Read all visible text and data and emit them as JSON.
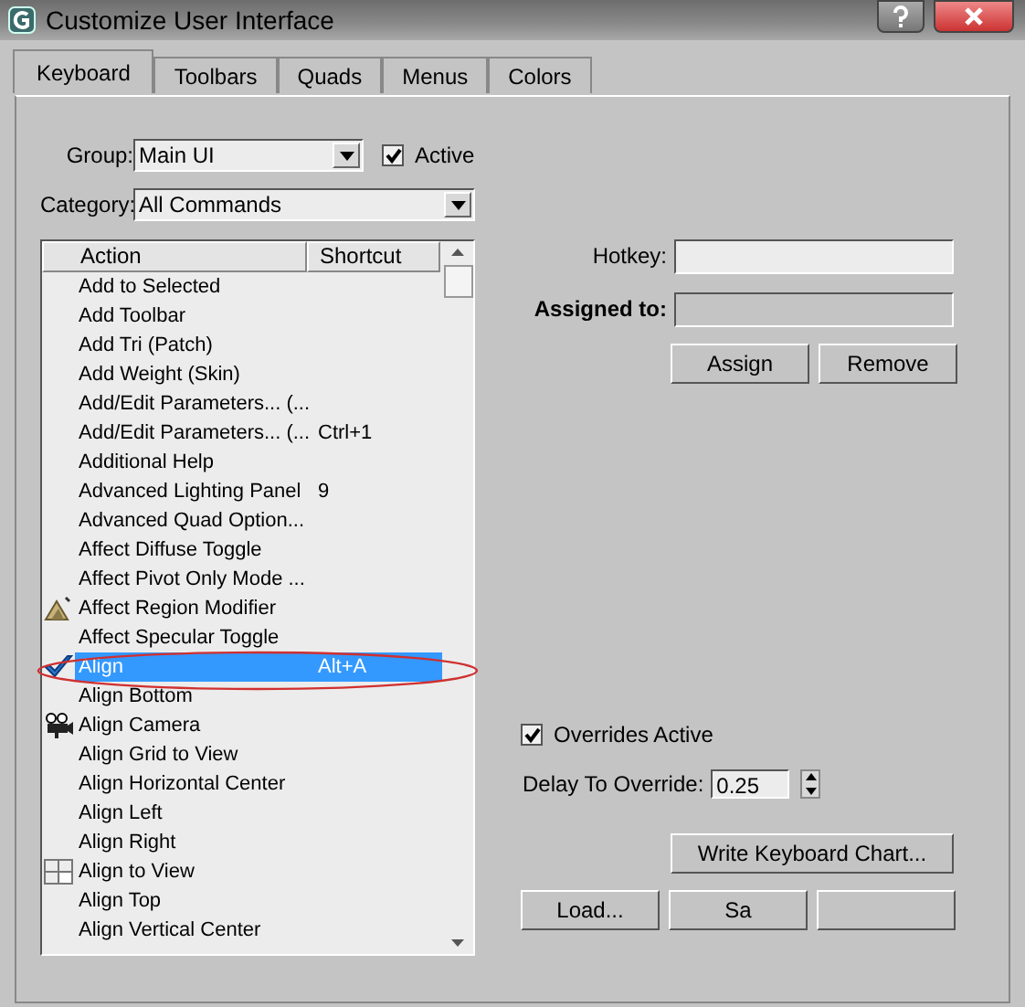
{
  "window": {
    "title": "Customize User Interface"
  },
  "tabs": [
    {
      "label": "Keyboard",
      "selected": true
    },
    {
      "label": "Toolbars",
      "selected": false
    },
    {
      "label": "Quads",
      "selected": false
    },
    {
      "label": "Menus",
      "selected": false
    },
    {
      "label": "Colors",
      "selected": false
    }
  ],
  "group": {
    "label": "Group:",
    "value": "Main UI"
  },
  "active": {
    "label": "Active",
    "checked": true
  },
  "category": {
    "label": "Category:",
    "value": "All Commands"
  },
  "table": {
    "columns": [
      "Action",
      "Shortcut"
    ],
    "rows": [
      {
        "action": "Add to Selected",
        "selected": false,
        "kind": "plain"
      },
      {
        "action": "Add Toolbar",
        "selected": false,
        "kind": "plain"
      },
      {
        "action": "Add Tri (Patch)",
        "selected": false,
        "kind": "plain"
      },
      {
        "action": "Add Weight (Skin)",
        "selected": false,
        "kind": "plain"
      },
      {
        "action": "Add/Edit Parameters... (...",
        "selected": false,
        "kind": "plain"
      },
      {
        "action": "Add/Edit Parameters... (...",
        "shortcut": "Ctrl+1",
        "selected": false,
        "kind": "plain"
      },
      {
        "action": "Additional Help",
        "selected": false,
        "kind": "plain"
      },
      {
        "action": "Advanced Lighting Panel",
        "shortcut": "9",
        "selected": false,
        "kind": "plain"
      },
      {
        "action": "Advanced Quad Option...",
        "selected": false,
        "kind": "plain"
      },
      {
        "action": "Affect Diffuse Toggle",
        "selected": false,
        "kind": "plain"
      },
      {
        "action": "Affect Pivot Only Mode ...",
        "selected": false,
        "kind": "plain"
      },
      {
        "action": "Affect Region Modifier",
        "selected": false,
        "kind": "region"
      },
      {
        "action": "Affect Specular Toggle",
        "selected": false,
        "kind": "plain"
      },
      {
        "action": "Align",
        "shortcut": "Alt+A",
        "selected": true,
        "kind": "align"
      },
      {
        "action": "Align Bottom",
        "selected": false,
        "kind": "plain"
      },
      {
        "action": "Align Camera",
        "selected": false,
        "kind": "camera"
      },
      {
        "action": "Align Grid to View",
        "selected": false,
        "kind": "plain"
      },
      {
        "action": "Align Horizontal Center",
        "selected": false,
        "kind": "plain"
      },
      {
        "action": "Align Left",
        "selected": false,
        "kind": "plain"
      },
      {
        "action": "Align Right",
        "selected": false,
        "kind": "plain"
      },
      {
        "action": "Align to View",
        "selected": false,
        "kind": "view"
      },
      {
        "action": "Align Top",
        "selected": false,
        "kind": "plain"
      },
      {
        "action": "Align Vertical Center",
        "selected": false,
        "kind": "plain"
      }
    ]
  },
  "hotkey": {
    "label": "Hotkey:"
  },
  "assigned_to": {
    "label": "Assigned to:",
    "disabled": true
  },
  "assign_buttons": [
    "Assign",
    "Remove"
  ],
  "overrides_active": {
    "label": "Overrides Active",
    "checked": true
  },
  "delay": {
    "label": "Delay To Override:",
    "value": "0.25"
  },
  "chart_button": "Write Keyboard Chart...",
  "bottom_buttons": [
    "Load...",
    "Sa"
  ]
}
